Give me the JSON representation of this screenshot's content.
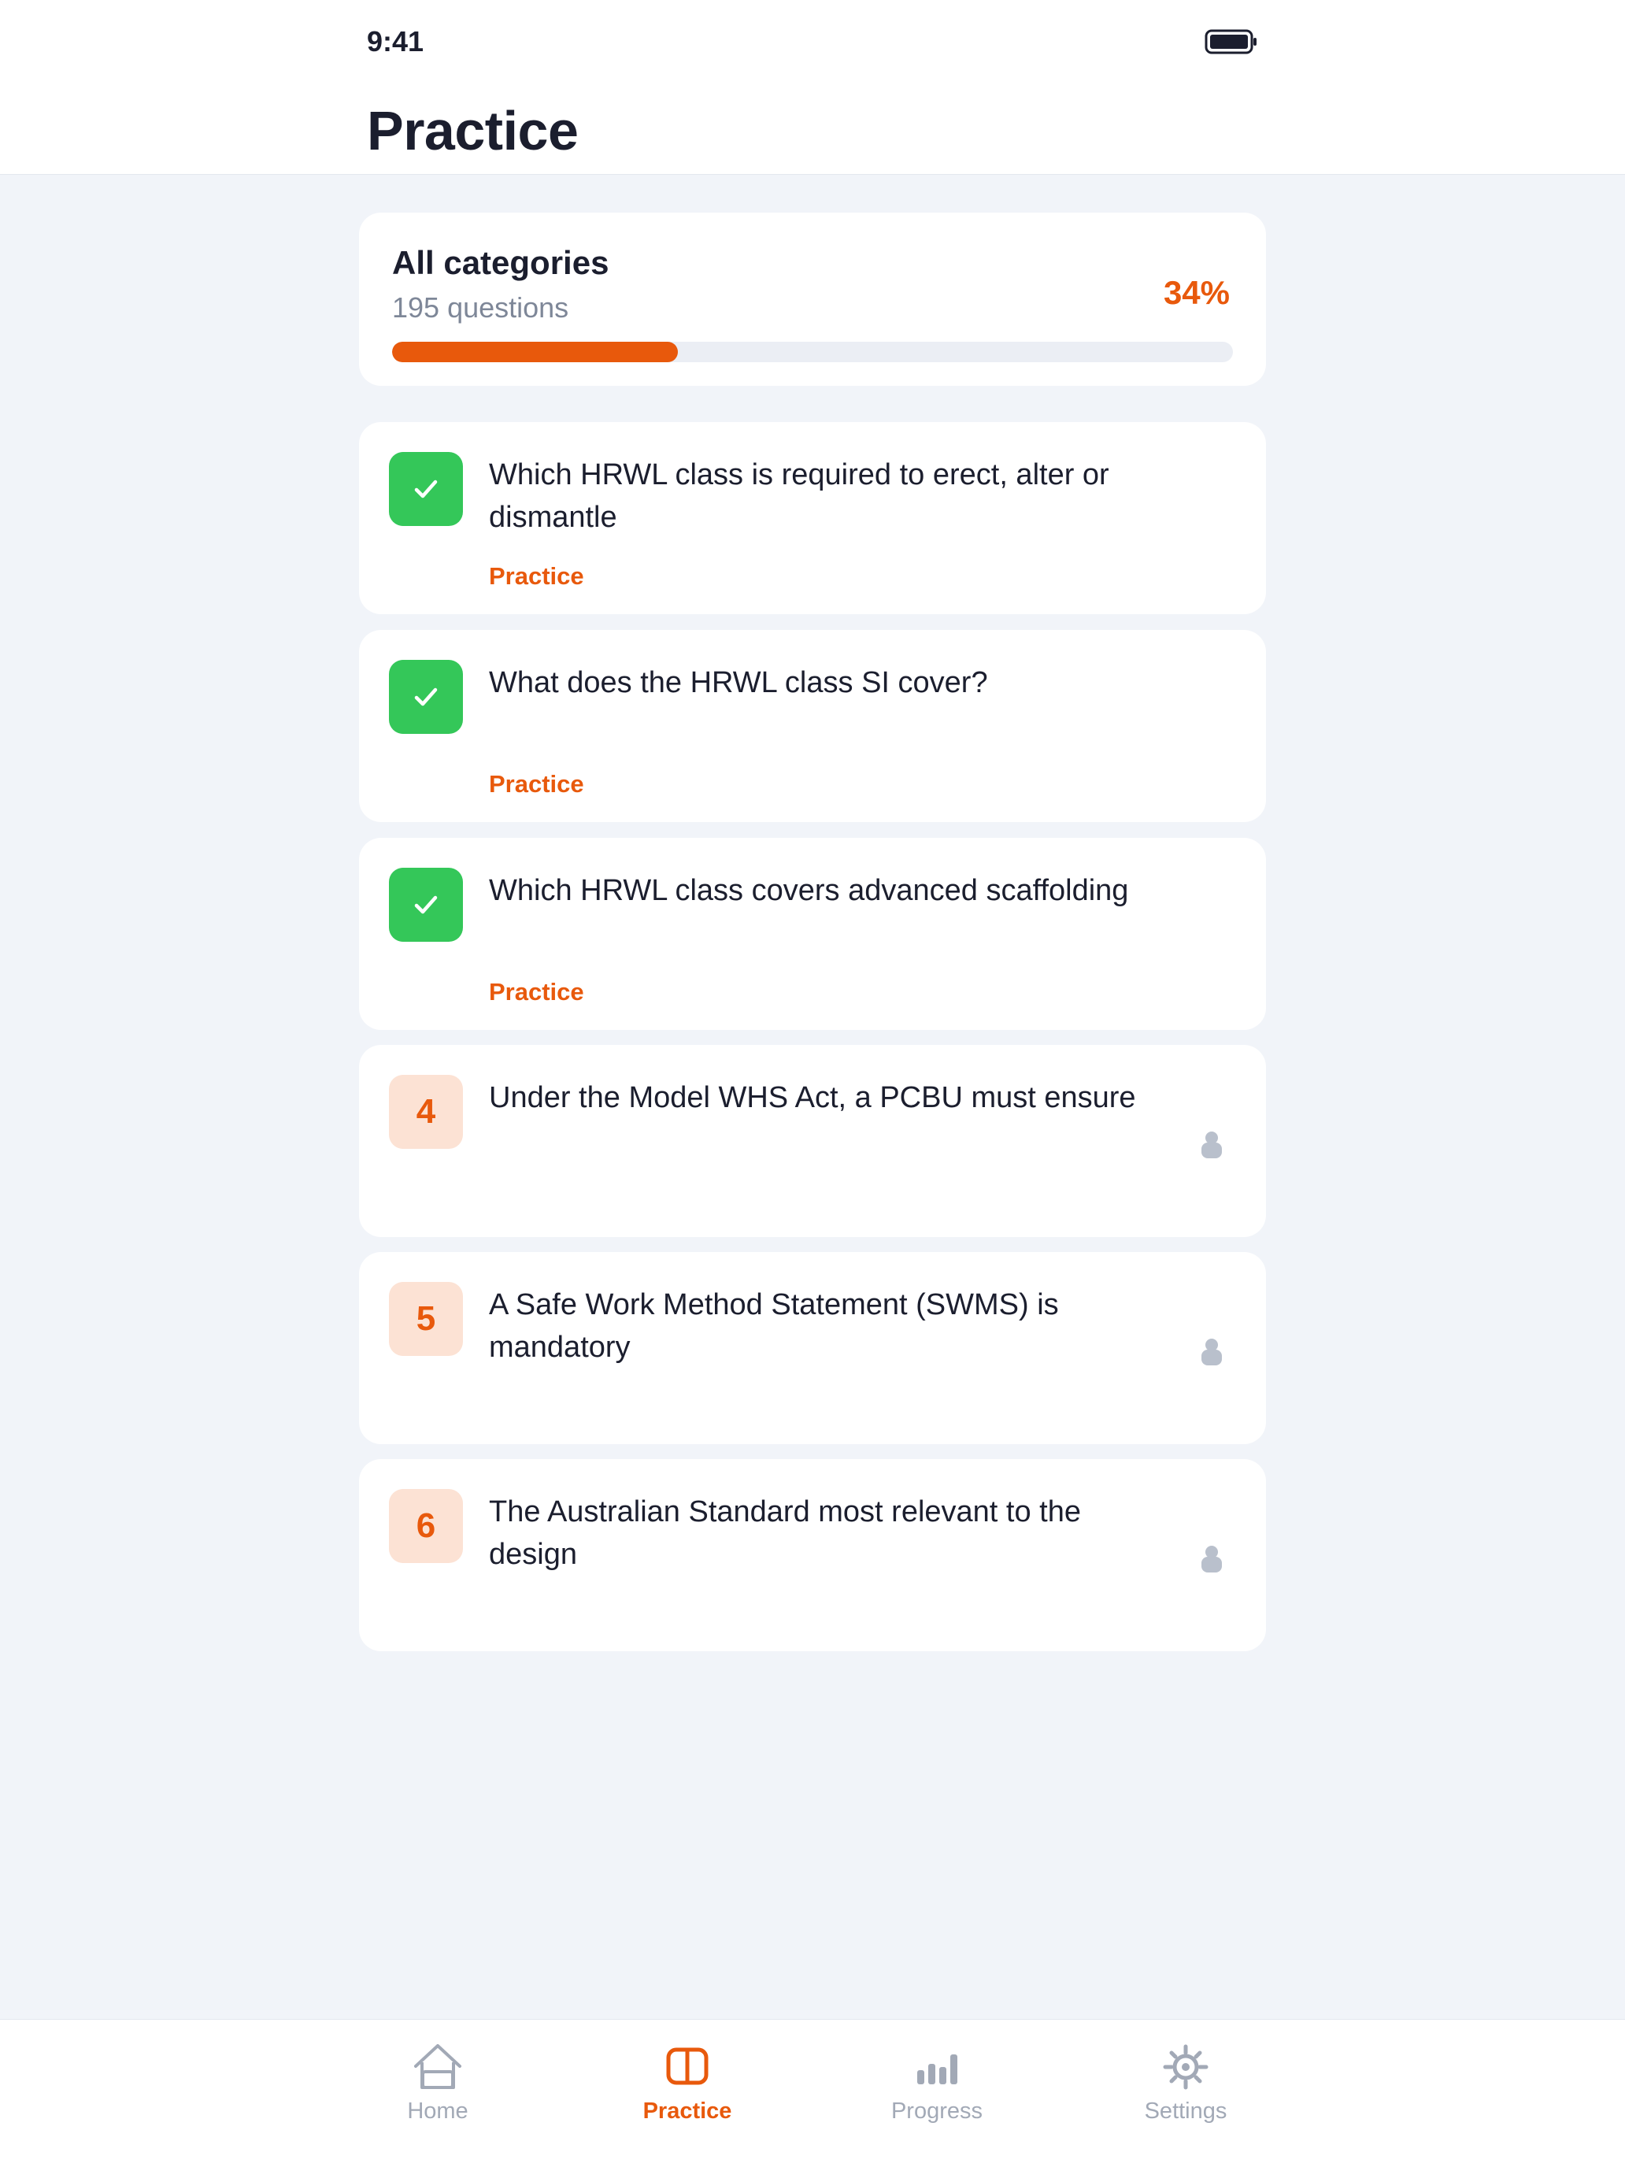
{
  "status_bar": {
    "time": "9:41"
  },
  "header": {
    "title": "Practice"
  },
  "summary": {
    "title": "All categories",
    "subtitle": "195 questions",
    "percent_label": "34%",
    "progress": 0.34
  },
  "questions": [
    {
      "state": "done",
      "text": "Which HRWL class is required to erect, alter or dismantle",
      "tag": "Practice"
    },
    {
      "state": "done",
      "text": "What does the HRWL class SI cover?",
      "tag": "Practice"
    },
    {
      "state": "done",
      "text": "Which HRWL class covers advanced scaffolding",
      "tag": "Practice"
    },
    {
      "state": "locked",
      "number": "4",
      "text": "Under the Model WHS Act, a PCBU must ensure"
    },
    {
      "state": "locked",
      "number": "5",
      "text": "A Safe Work Method Statement (SWMS) is mandatory"
    },
    {
      "state": "locked",
      "number": "6",
      "text": "The Australian Standard most relevant to the design"
    }
  ],
  "tabbar": {
    "tabs": [
      {
        "label": "Home",
        "icon": "home-icon",
        "active": false
      },
      {
        "label": "Practice",
        "icon": "book-icon",
        "active": true
      },
      {
        "label": "Progress",
        "icon": "bar-chart-icon",
        "active": false
      },
      {
        "label": "Settings",
        "icon": "gear-icon",
        "active": false
      }
    ]
  },
  "colors": {
    "accent": "#E8590C",
    "success": "#34C759",
    "badge_bg": "#FCE2D4",
    "muted": "#A2A9B6",
    "background": "#F1F4F9"
  }
}
